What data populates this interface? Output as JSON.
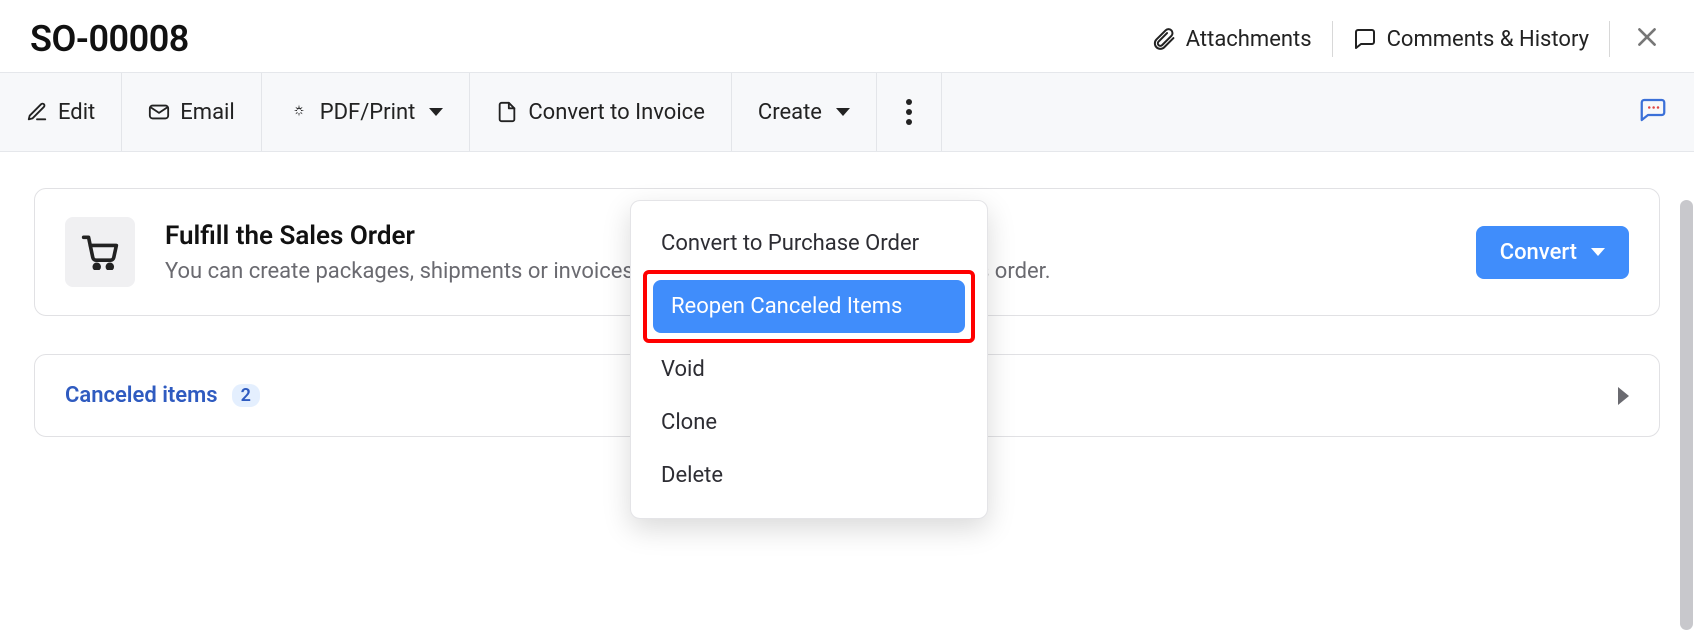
{
  "page": {
    "title": "SO-00008"
  },
  "header_actions": {
    "attachments_label": "Attachments",
    "comments_label": "Comments & History"
  },
  "toolbar": {
    "edit_label": "Edit",
    "email_label": "Email",
    "pdf_label": "PDF/Print",
    "convert_invoice_label": "Convert to Invoice",
    "create_label": "Create"
  },
  "more_menu": {
    "items": [
      {
        "label": "Convert to Purchase Order",
        "highlighted": false
      },
      {
        "label": "Reopen Canceled Items",
        "highlighted": true
      },
      {
        "label": "Void",
        "highlighted": false
      },
      {
        "label": "Clone",
        "highlighted": false
      },
      {
        "label": "Delete",
        "highlighted": false
      }
    ]
  },
  "fulfill_card": {
    "title": "Fulfill the Sales Order",
    "subtitle": "You can create packages, shipments or invoices (in any order) to complete this sales order.",
    "button_label": "Convert"
  },
  "canceled_panel": {
    "label": "Canceled items",
    "count": "2"
  }
}
